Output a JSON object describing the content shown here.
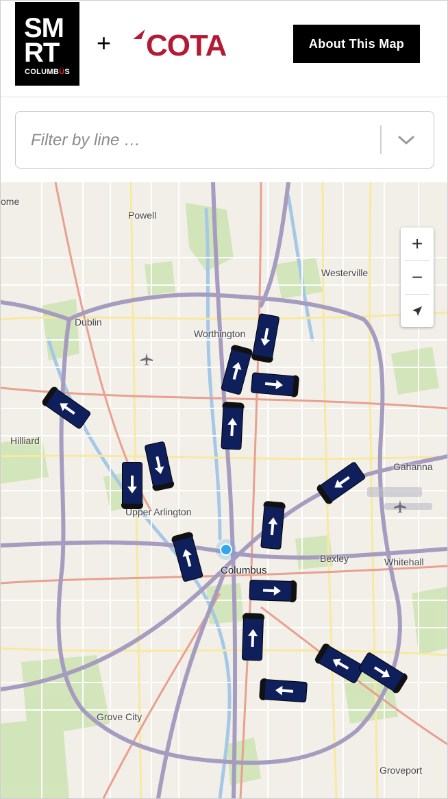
{
  "header": {
    "smrt_logo": {
      "line1": "SM",
      "line2": "RT",
      "city": "COLUMB",
      "city_accent": "Ü",
      "city_end": "S"
    },
    "plus": "+",
    "cota_logo": "COTA",
    "about_button": "About This Map"
  },
  "filter": {
    "placeholder": "Filter by line …",
    "value": "",
    "dropdown_icon": "chevron-down-icon"
  },
  "map": {
    "places": {
      "powell": "Powell",
      "westerville": "Westerville",
      "dublin": "Dublin",
      "worthington": "Worthington",
      "hilliard": "Hilliard",
      "gahanna": "Gahanna",
      "upper_arlington": "Upper Arlington",
      "bexley": "Bexley",
      "whitehall": "Whitehall",
      "columbus": "Columbus",
      "grove_city": "Grove City",
      "groveport": "Groveport",
      "edge_label": "ome"
    },
    "controls": {
      "zoom_in": "+",
      "zoom_out": "−",
      "locate_icon": "navigation-arrow-icon"
    },
    "bus_icon": "bus-icon",
    "bus_color": "#0f1f5c",
    "location_color": "#33a6f0"
  }
}
